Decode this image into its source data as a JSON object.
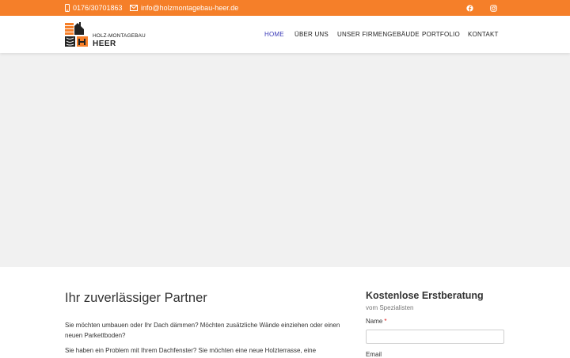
{
  "topbar": {
    "phone": "0176/30701863",
    "email": "info@holzmontagebau-heer.de",
    "phone_icon": "phone-icon",
    "email_icon": "envelope-icon",
    "social_icons": [
      "facebook-icon",
      "instagram-icon"
    ],
    "background_color": "#f57f29"
  },
  "logo": {
    "line1": "HOLZ-MONTAGEBAU",
    "line2": "HEER"
  },
  "nav": {
    "items": [
      {
        "label": "HOME"
      },
      {
        "label": "ÜBER UNS"
      },
      {
        "label": "UNSER FIRMENGEBÄUDE"
      },
      {
        "label": "PORTFOLIO"
      },
      {
        "label": "KONTAKT"
      }
    ],
    "active_color": "#3b3bb8"
  },
  "main": {
    "heading": "Ihr zuverlässiger Partner",
    "paragraph1": "Sie möchten umbauen oder Ihr Dach dämmen? Möchten zusätzliche Wände einziehen oder einen neuen Parkettboden?",
    "paragraph2": "Sie haben ein Problem mit Ihrem Dachfenster? Sie möchten eine neue Holzterrasse, eine"
  },
  "form": {
    "title": "Kostenlose Erstberatung",
    "subtitle": "vom Spezialisten",
    "name_label": "Name",
    "required_mark": "*",
    "email_label": "Email"
  }
}
